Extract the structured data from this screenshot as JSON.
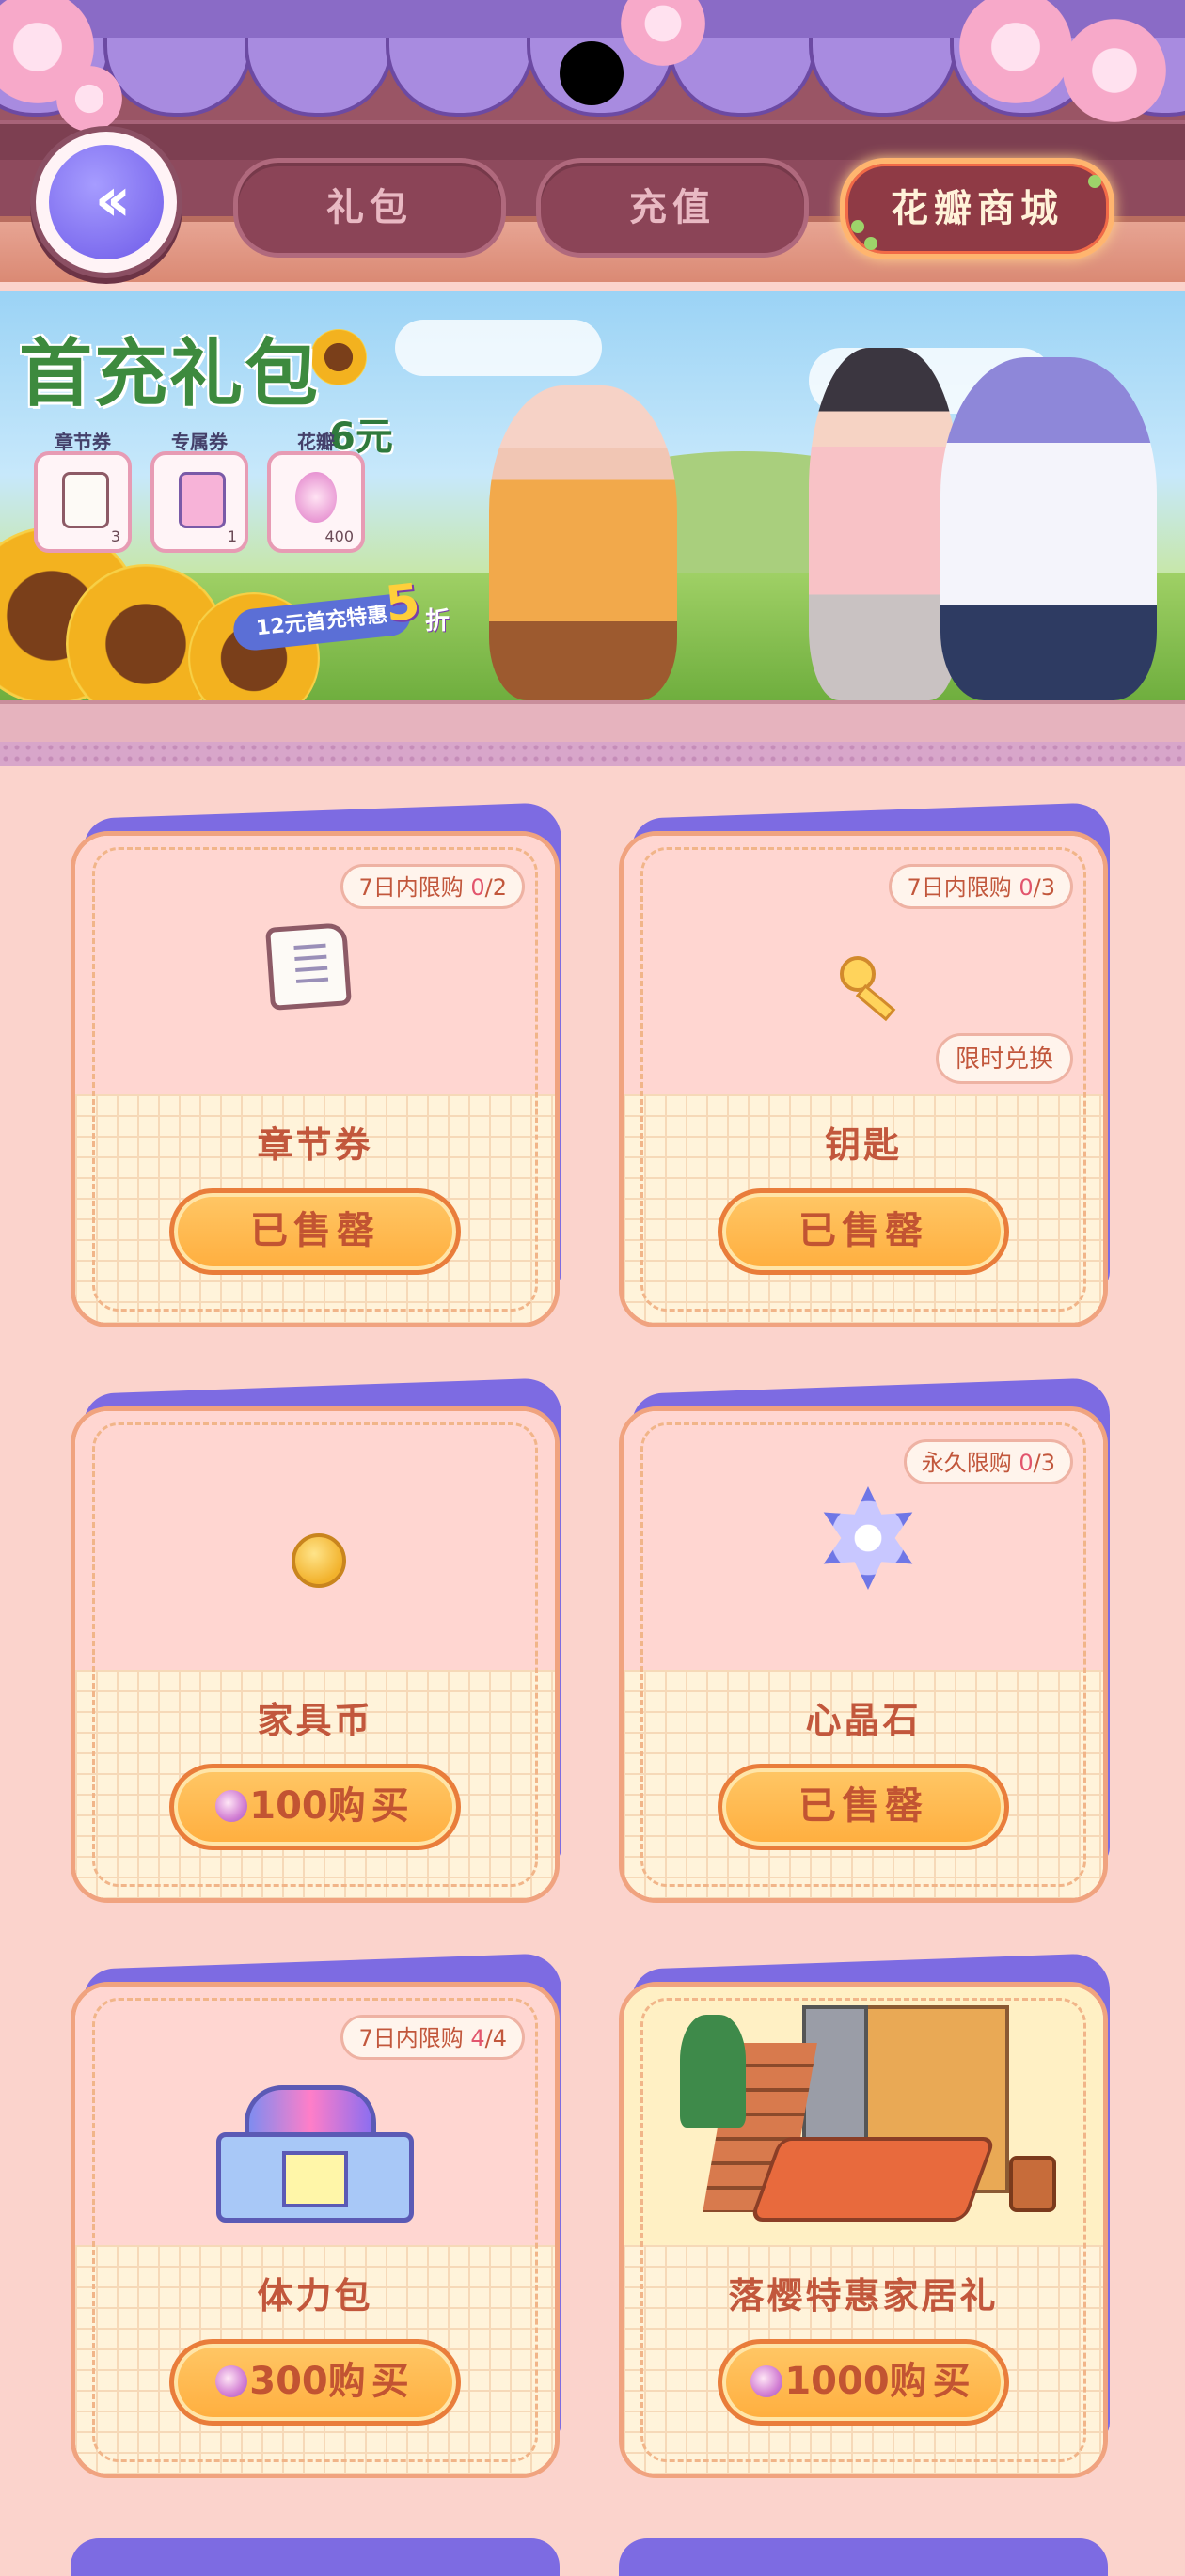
{
  "header": {
    "back_icon": "double-chevron-left-icon",
    "tabs": [
      {
        "label": "礼包",
        "active": false
      },
      {
        "label": "充值",
        "active": false
      },
      {
        "label": "花瓣商城",
        "active": true
      }
    ]
  },
  "banner": {
    "title": "首充礼包",
    "price": "6元",
    "items": [
      {
        "label": "章节券",
        "count": "3"
      },
      {
        "label": "专属券",
        "count": "1"
      },
      {
        "label": "花瓣",
        "count": "400"
      }
    ],
    "promo_text": "12元首充特惠",
    "promo_discount": "5",
    "promo_unit": "折"
  },
  "cards": [
    {
      "name": "章节券",
      "limit_prefix": "7日内限购 ",
      "limit_count": "0",
      "limit_total": "/2",
      "button": "已售罄",
      "icon": "ticket-book-icon"
    },
    {
      "name": "钥匙",
      "limit_prefix": "7日内限购 ",
      "limit_count": "0",
      "limit_total": "/3",
      "tag": "限时兑换",
      "button": "已售罄",
      "icon": "key-icon"
    },
    {
      "name": "家具币",
      "button_price": "100",
      "button_suffix": "购买",
      "icon": "coin-icon"
    },
    {
      "name": "心晶石",
      "limit_prefix": "永久限购 ",
      "limit_count": "0",
      "limit_total": "/3",
      "button": "已售罄",
      "icon": "heart-crystal-icon"
    },
    {
      "name": "体力包",
      "limit_prefix": "7日内限购 ",
      "limit_count": "4",
      "limit_total": "/4",
      "button_price": "300",
      "button_suffix": "购买",
      "icon": "stamina-box-icon"
    },
    {
      "name": "落樱特惠家居礼",
      "button_price": "1000",
      "button_suffix": "购买",
      "icon": "furniture-set-icon"
    }
  ],
  "colors": {
    "accent_text": "#c2573c",
    "button_fill": "#ffb44a",
    "card_top": "#7d6be2",
    "page_bg": "#fbd3cc"
  }
}
